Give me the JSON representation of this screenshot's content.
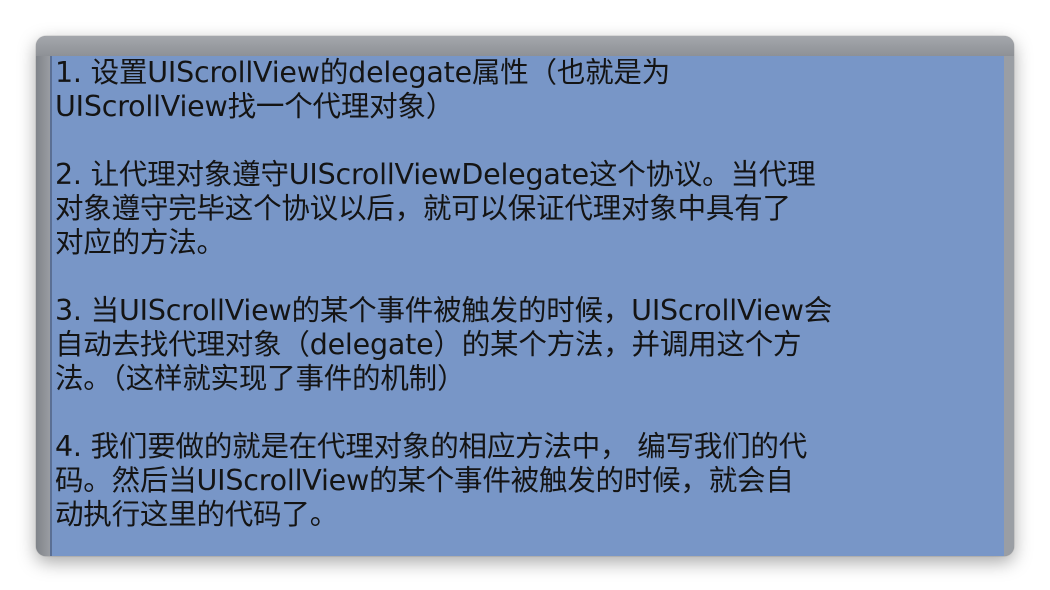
{
  "document": {
    "paragraphs": [
      {
        "lines": [
          "1. 设置UIScrollView的delegate属性（也就是为",
          "UIScrollView找一个代理对象）"
        ]
      },
      {
        "lines": [
          "2. 让代理对象遵守UIScrollViewDelegate这个协议。当代理",
          "对象遵守完毕这个协议以后，就可以保证代理对象中具有了",
          "对应的方法。"
        ]
      },
      {
        "lines": [
          "3. 当UIScrollView的某个事件被触发的时候，UIScrollView会",
          "自动去找代理对象（delegate）的某个方法，并调用这个方",
          "法。（这样就实现了事件的机制）"
        ]
      },
      {
        "lines": [
          "4. 我们要做的就是在代理对象的相应方法中， 编写我们的代",
          "码。然后当UIScrollView的某个事件被触发的时候，就会自",
          "动执行这里的代码了。"
        ]
      }
    ]
  },
  "colors": {
    "content_background": "#7896c7",
    "text": "#141414",
    "window_frame": "#8b8f96"
  }
}
